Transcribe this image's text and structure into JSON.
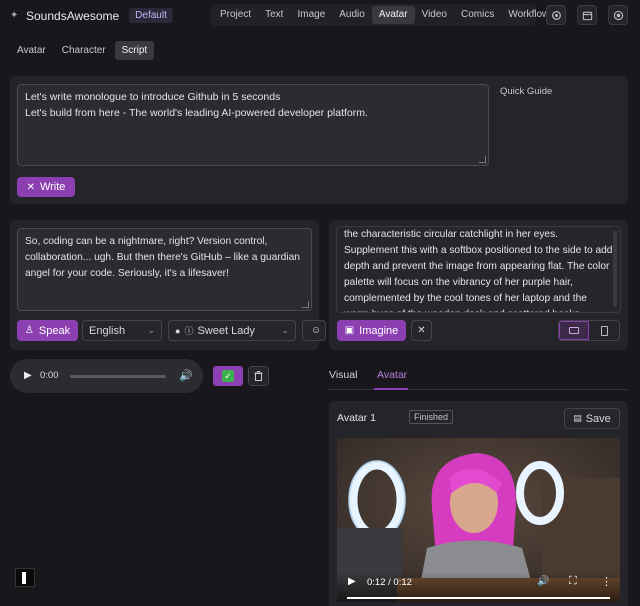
{
  "brand": {
    "name": "SoundsAwesome",
    "badge": "Default",
    "icon": "sparkle-icon"
  },
  "nav": {
    "items": [
      "Project",
      "Text",
      "Image",
      "Audio",
      "Avatar",
      "Video",
      "Comics",
      "Workflow"
    ],
    "active": "Avatar"
  },
  "header_icons": [
    "settings-icon",
    "calendar-icon",
    "target-icon"
  ],
  "subtabs": {
    "items": [
      "Avatar",
      "Character",
      "Script"
    ],
    "active": "Script"
  },
  "prompt": {
    "lines": [
      "Let's write monologue to introduce Github in 5 seconds",
      "Let's build from here - The world's leading AI-powered developer platform."
    ],
    "quick_guide": "Quick Guide",
    "write_label": "Write"
  },
  "script": {
    "text": "So, coding can be a nightmare, right?  Version control, collaboration... ugh.  But then there's GitHub – like a guardian angel for your code.  Seriously, it's a lifesaver!",
    "speak_label": "Speak",
    "language": "English",
    "voice": "Sweet Lady",
    "extra_button": "E"
  },
  "image_prompt": {
    "text": "the characteristic circular catchlight in her eyes. Supplement this with a softbox positioned to the side to add depth and prevent the image from appearing flat. The color palette will focus on the vibrancy of her purple hair, complemented by the cool tones of her laptop and the warm hues of the wooden desk and scattered books.",
    "imagine_label": "Imagine"
  },
  "audio": {
    "time": "0:00",
    "progress": 0.0
  },
  "result_tabs": {
    "items": [
      "Visual",
      "Avatar"
    ],
    "active": "Avatar"
  },
  "avatar_card": {
    "title": "Avatar 1",
    "status": "Finished",
    "save_label": "Save",
    "video_time": "0:12 / 0:12",
    "video_progress": 1.0
  },
  "colors": {
    "accent": "#8b3fb0",
    "accent_text": "#c4b5fd",
    "background": "#18171c",
    "panel": "#25242a"
  }
}
